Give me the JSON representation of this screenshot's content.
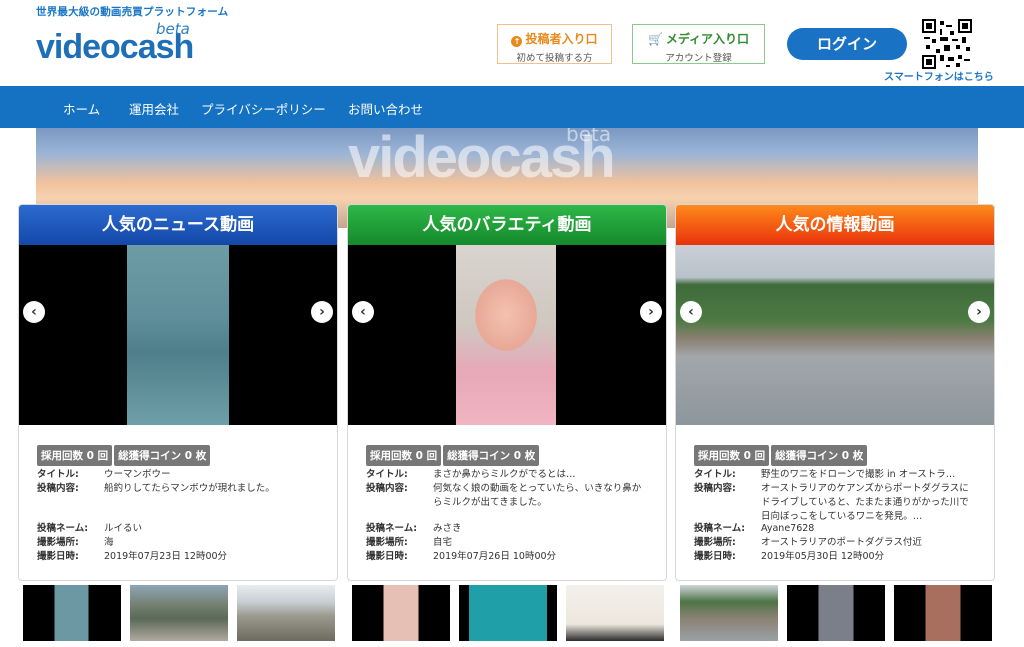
{
  "header": {
    "tagline": "世界最大級の動画売買プラットフォーム",
    "logo_text": "videocash",
    "logo_beta": "beta",
    "poster_entry": {
      "label": "投稿者入り口",
      "sub": "初めて投稿する方"
    },
    "media_entry": {
      "label": "メディア入り口",
      "sub": "アカウント登録"
    },
    "login_label": "ログイン",
    "smartphone_label": "スマートフォンはこちら"
  },
  "nav": {
    "items": [
      "ホーム",
      "運用会社",
      "プライバシーポリシー",
      "お問い合わせ"
    ]
  },
  "hero": {
    "logo_text": "videocash",
    "beta": "beta"
  },
  "cards": [
    {
      "title": "人気のニュース動画",
      "badge_count": "採用回数 0 回",
      "badge_coin": "総獲得コイン 0 枚",
      "labels": {
        "title": "タイトル:",
        "content": "投稿内容:",
        "poster": "投稿ネーム:",
        "place": "撮影場所:",
        "date": "撮影日時:"
      },
      "video_title": "ウーマンボウー",
      "content": "船釣りしてたらマンボウが現れました。",
      "poster": "ルイるい",
      "place": "海",
      "date": "2019年07月23日 12時00分"
    },
    {
      "title": "人気のバラエティ動画",
      "badge_count": "採用回数 0 回",
      "badge_coin": "総獲得コイン 0 枚",
      "labels": {
        "title": "タイトル:",
        "content": "投稿内容:",
        "poster": "投稿ネーム:",
        "place": "撮影場所:",
        "date": "撮影日時:"
      },
      "video_title": "まさか鼻からミルクがでるとは…",
      "content": "何気なく娘の動画をとっていたら、いきなり鼻からミルクが出てきました。",
      "poster": "みさき",
      "place": "自宅",
      "date": "2019年07月26日 10時00分"
    },
    {
      "title": "人気の情報動画",
      "badge_count": "採用回数 0 回",
      "badge_coin": "総獲得コイン 0 枚",
      "labels": {
        "title": "タイトル:",
        "content": "投稿内容:",
        "poster": "投稿ネーム:",
        "place": "撮影場所:",
        "date": "撮影日時:"
      },
      "video_title": "野生のワニをドローンで撮影 in オーストラ…",
      "content": "オーストラリアのケアンズからポートダグラスにドライブしていると、たまたま通りがかった川で日向ぼっこをしているワニを発見。…",
      "poster": "Ayane7628",
      "place": "オーストラリアのポートダグラス付近",
      "date": "2019年05月30日 12時00分"
    }
  ],
  "colors": {
    "brand": "#1572c3",
    "news": "#1f5cc0",
    "variety": "#22a03b",
    "info": "#f05a12"
  }
}
